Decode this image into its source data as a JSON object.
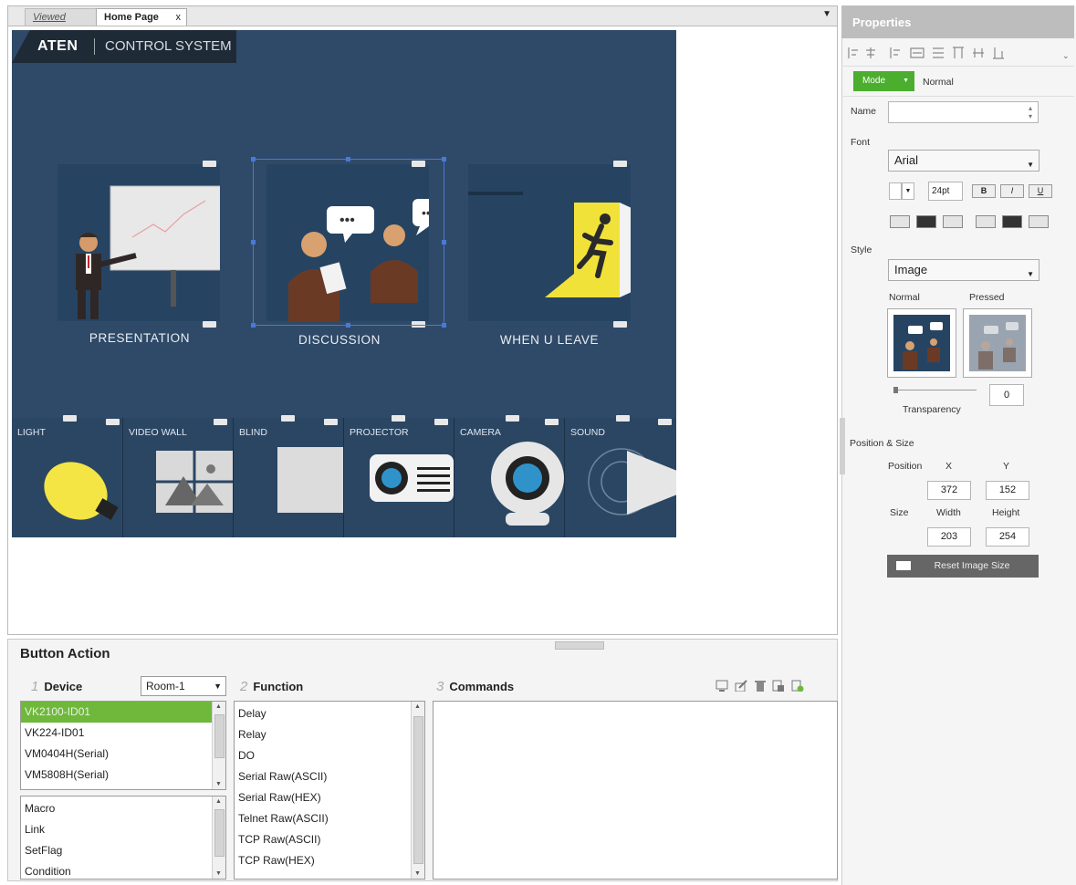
{
  "tabs": {
    "viewed": "Viewed",
    "home": "Home Page",
    "close": "x",
    "dropdown": "▼"
  },
  "panel": {
    "brand_name": "ATEN",
    "brand_sub": "CONTROL SYSTEM",
    "tiles": [
      {
        "label": "PRESENTATION"
      },
      {
        "label": "DISCUSSION"
      },
      {
        "label": "WHEN U LEAVE"
      }
    ],
    "devices": [
      {
        "label": "LIGHT"
      },
      {
        "label": "VIDEO WALL"
      },
      {
        "label": "BLIND"
      },
      {
        "label": "PROJECTOR"
      },
      {
        "label": "CAMERA"
      },
      {
        "label": "SOUND"
      }
    ],
    "colors": {
      "bg": "#2f4a68",
      "tile": "#264462",
      "exit_sign": "#f1e23a",
      "selection": "#4b78d8"
    }
  },
  "button_action": {
    "title": "Button Action",
    "device": {
      "num": "1",
      "label": "Device",
      "room": "Room-1",
      "items": [
        "VK2100-ID01",
        "VK224-ID01",
        "VM0404H(Serial)",
        "VM5808H(Serial)"
      ],
      "selected_index": 0,
      "items2": [
        "Macro",
        "Link",
        "SetFlag",
        "Condition"
      ]
    },
    "function": {
      "num": "2",
      "label": "Function",
      "items": [
        "Delay",
        "Relay",
        "DO",
        "Serial Raw(ASCII)",
        "Serial Raw(HEX)",
        "Telnet Raw(ASCII)",
        "TCP Raw(ASCII)",
        "TCP Raw(HEX)"
      ]
    },
    "commands": {
      "num": "3",
      "label": "Commands"
    }
  },
  "properties": {
    "title": "Properties",
    "mode_button": "Mode",
    "mode_value": "Normal",
    "name_label": "Name",
    "name_value": "",
    "font_label": "Font",
    "font_family": "Arial",
    "font_size": "24pt",
    "bold": "B",
    "italic": "I",
    "underline": "U",
    "style_label": "Style",
    "style_value": "Image",
    "normal_label": "Normal",
    "pressed_label": "Pressed",
    "transparency_label": "Transparency",
    "transparency_value": "0",
    "possize_label": "Position & Size",
    "position_label": "Position",
    "size_label": "Size",
    "x_label": "X",
    "y_label": "Y",
    "x": "372",
    "y": "152",
    "width_label": "Width",
    "height_label": "Height",
    "width": "203",
    "height": "254",
    "reset_button": "Reset Image Size",
    "colors": {
      "mode_button": "#4cae2e",
      "reset_button": "#666666"
    }
  }
}
